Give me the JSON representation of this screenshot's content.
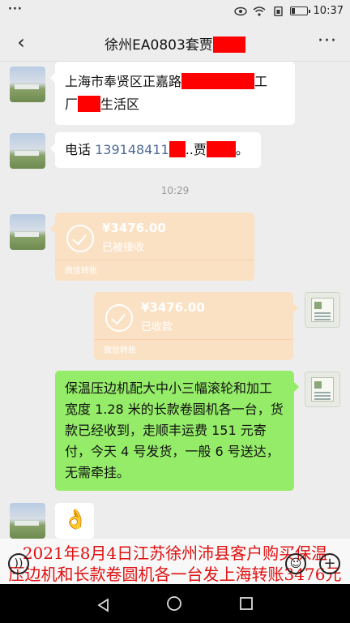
{
  "status_bar": {
    "left": "···",
    "time": "10:37"
  },
  "header": {
    "title": "徐州EA0803套贾",
    "back": "‹",
    "more": "···"
  },
  "messages": {
    "address_line1": "上海市奉贤区正嘉路",
    "address_line1_end": "工",
    "address_line2_start": "厂",
    "address_line2_end": "生活区",
    "phone_label": "电话 ",
    "phone_number": "139148411",
    "phone_suffix": "..贾",
    "phone_end": "。",
    "timestamp": "10:29",
    "transfer_received": {
      "amount": "¥3476.00",
      "status": "已被接收",
      "footer": "微信转账"
    },
    "transfer_collected": {
      "amount": "¥3476.00",
      "status": "已收款",
      "footer": "微信转账"
    },
    "reply_text": "保温压边机配大中小三幅滚轮和加工宽度 1.28 米的长款卷圆机各一台，货款已经收到，走顺丰运费 151 元寄付，今天 4 号发货，一般 6 号送达，无需牵挂。",
    "emoji": "👌"
  },
  "caption": {
    "line1": "2021年8月4日江苏徐州沛县客户购买保温",
    "line2": "压边机和长款卷圆机各一台发上海转账3476元"
  },
  "colors": {
    "accent_green": "#95ec69",
    "transfer_orange": "#fbe1c4",
    "caption_red": "#e01010",
    "redaction": "#ff0000"
  }
}
